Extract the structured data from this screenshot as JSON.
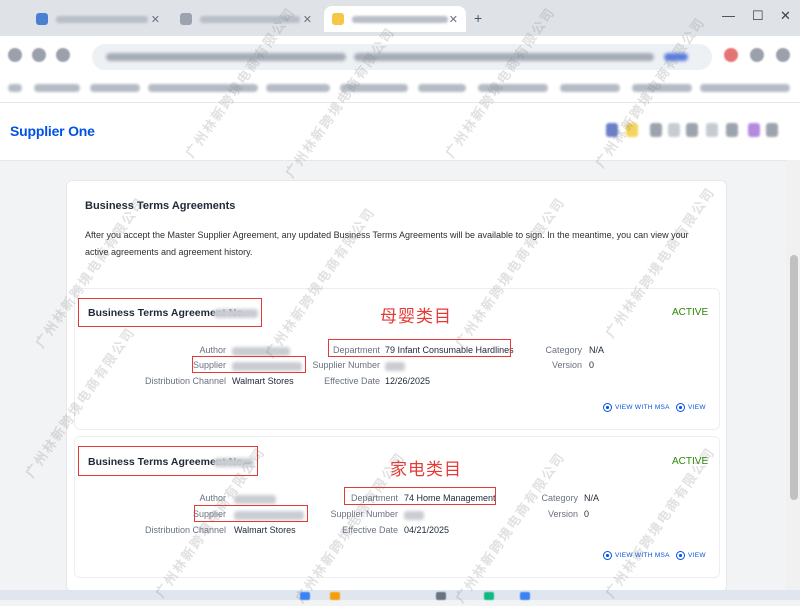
{
  "app": {
    "brand": "Supplier One"
  },
  "section": {
    "title": "Business Terms Agreements",
    "description": "After you accept the Master Supplier Agreement, any updated Business Terms Agreements will be available to sign. In the meantime, you can view your active agreements and agreement history."
  },
  "labels": {
    "author": "Author",
    "supplier": "Supplier",
    "distribution_channel": "Distribution Channel",
    "department": "Department",
    "supplier_number": "Supplier Number",
    "effective_date": "Effective Date",
    "category": "Category",
    "version": "Version",
    "view_with_msa": "VIEW WITH MSA",
    "view": "VIEW"
  },
  "agreements": [
    {
      "title": "Business Terms Agreement No.",
      "status": "ACTIVE",
      "distribution_channel": "Walmart Stores",
      "department": "79 Infant Consumable Hardlines",
      "effective_date": "12/26/2025",
      "category": "N/A",
      "version": "0",
      "annotation": "母婴类目"
    },
    {
      "title": "Business Terms Agreement No.",
      "status": "ACTIVE",
      "distribution_channel": "Walmart Stores",
      "department": "74 Home Management",
      "effective_date": "04/21/2025",
      "category": "N/A",
      "version": "0",
      "annotation": "家电类目"
    }
  ],
  "watermark": "广州林新跨境电商有限公司",
  "colors": {
    "brand_blue": "#0053e2",
    "active_green": "#2a8703",
    "annotation_red": "#e53935"
  }
}
